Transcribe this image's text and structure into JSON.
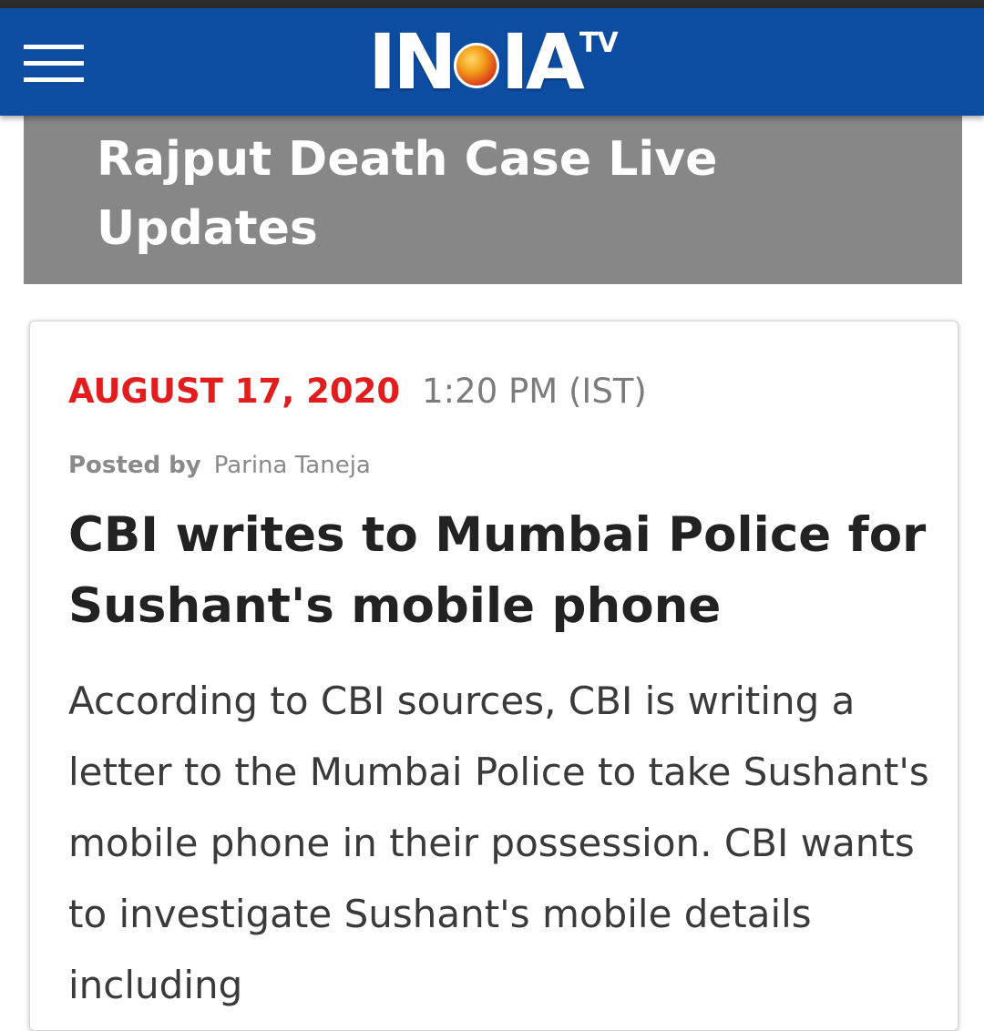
{
  "header": {
    "menu_icon": "hamburger-menu-icon",
    "logo_text": "INDIA",
    "logo_superscript": "TV",
    "background_color": "#0c4da2"
  },
  "banner": {
    "title": "Rajput Death Case Live Updates",
    "background_color": "#878787"
  },
  "post": {
    "date": "AUGUST 17, 2020",
    "time": "1:20 PM (IST)",
    "posted_by_label": "Posted by",
    "author": "Parina Taneja",
    "headline": "CBI writes to Mumbai Police for Sushant's mobile phone",
    "body": "According to CBI sources, CBI is writing a letter to the Mumbai Police to take Sushant's mobile phone in their possession. CBI wants to investigate Sushant's mobile details including",
    "date_color": "#e11d1d"
  }
}
